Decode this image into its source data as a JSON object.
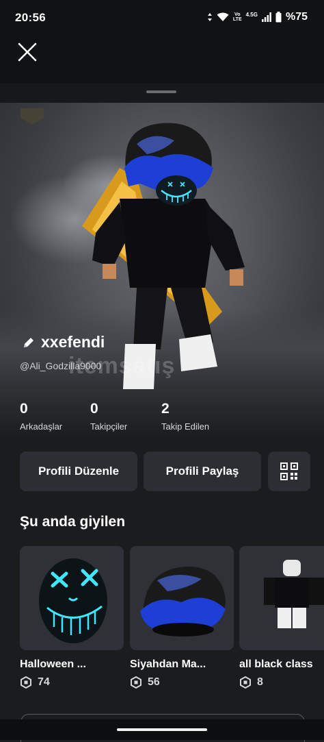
{
  "status_bar": {
    "time": "20:56",
    "volte": "Vo",
    "lte": "LTE",
    "network": "4.5G",
    "battery": "%75"
  },
  "profile": {
    "display_name": "xxefendi",
    "username": "@Ali_Godzilla9000",
    "watermark": "itemsatış",
    "stats": [
      {
        "value": "0",
        "label": "Arkadaşlar"
      },
      {
        "value": "0",
        "label": "Takipçiler"
      },
      {
        "value": "2",
        "label": "Takip Edilen"
      }
    ]
  },
  "actions": {
    "edit_label": "Profili Düzenle",
    "share_label": "Profili Paylaş"
  },
  "wearing": {
    "title": "Şu anda giyilen",
    "items": [
      {
        "name": "Halloween ...",
        "price": "74"
      },
      {
        "name": "Siyahdan Ma...",
        "price": "56"
      },
      {
        "name": "all black class",
        "price": "8"
      }
    ]
  },
  "colors": {
    "accent_blue": "#1d3fd6",
    "neon_cyan": "#3fe8ff",
    "background": "#1b1c1e"
  }
}
